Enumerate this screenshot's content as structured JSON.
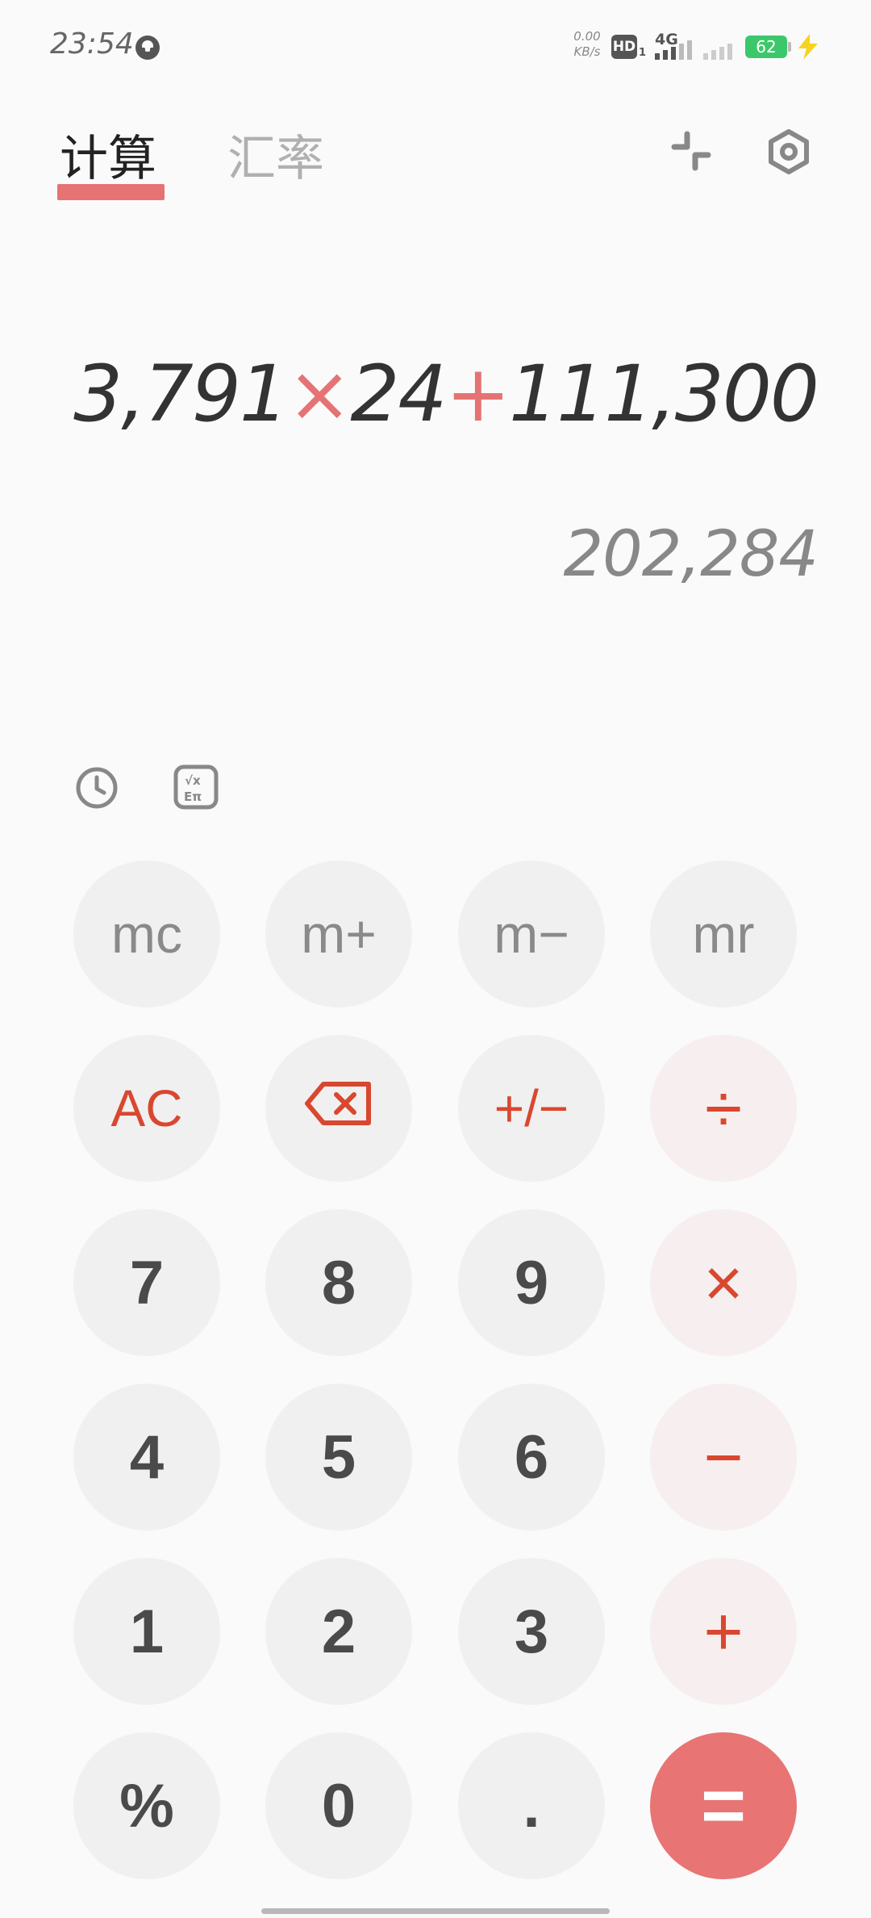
{
  "status_bar": {
    "time": "23:54",
    "net_speed_value": "0.00",
    "net_speed_unit": "KB/s",
    "hd_label": "HD",
    "hd_sub": "1",
    "network": "4G",
    "battery": "62",
    "battery_color": "#3cc86a"
  },
  "tabs": {
    "calculate": "计算",
    "exchange_rate": "汇率"
  },
  "display": {
    "expr_part1": "3,791",
    "op1": "×",
    "expr_part2": "24",
    "op2": "+",
    "expr_part3": "111,300",
    "result": "202,284"
  },
  "keys": {
    "mc": "mc",
    "mplus": "m+",
    "mminus": "m−",
    "mr": "mr",
    "ac": "AC",
    "plusminus": "+/−",
    "divide": "÷",
    "seven": "7",
    "eight": "8",
    "nine": "9",
    "multiply": "×",
    "four": "4",
    "five": "5",
    "six": "6",
    "minus": "−",
    "one": "1",
    "two": "2",
    "three": "3",
    "plus": "+",
    "percent": "%",
    "zero": "0",
    "dot": ".",
    "equals": "="
  },
  "colors": {
    "accent": "#e57373",
    "operator_text": "#d9472f",
    "equals_bg": "#e87474"
  }
}
